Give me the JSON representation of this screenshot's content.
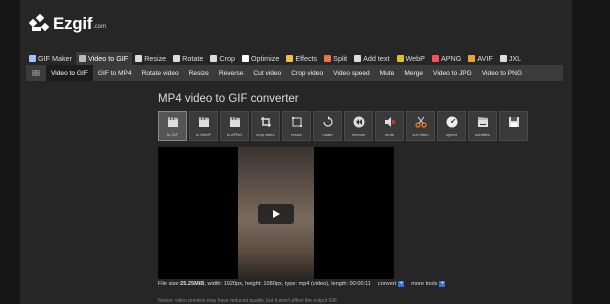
{
  "brand": {
    "name": "Ezgif",
    "suffix": ".com"
  },
  "topnav": [
    {
      "label": "GIF Maker",
      "icon": "gif-maker-icon",
      "color": "#9fc3ff",
      "active": false
    },
    {
      "label": "Video to GIF",
      "icon": "video-icon",
      "color": "#bbbbbb",
      "active": true
    },
    {
      "label": "Resize",
      "icon": "resize-icon",
      "color": "#dddddd",
      "active": false
    },
    {
      "label": "Rotate",
      "icon": "rotate-icon",
      "color": "#dddddd",
      "active": false
    },
    {
      "label": "Crop",
      "icon": "crop-icon",
      "color": "#dddddd",
      "active": false
    },
    {
      "label": "Optimize",
      "icon": "optimize-icon",
      "color": "#ffffff",
      "active": false
    },
    {
      "label": "Effects",
      "icon": "effects-icon",
      "color": "#f0c040",
      "active": false
    },
    {
      "label": "Split",
      "icon": "split-icon",
      "color": "#f07050",
      "active": false
    },
    {
      "label": "Add text",
      "icon": "add-text-icon",
      "color": "#dddddd",
      "active": false
    },
    {
      "label": "WebP",
      "icon": "webp-icon",
      "color": "#e0c020",
      "active": false
    },
    {
      "label": "APNG",
      "icon": "apng-icon",
      "color": "#ff5050",
      "active": false
    },
    {
      "label": "AVIF",
      "icon": "avif-icon",
      "color": "#f0a030",
      "active": false
    },
    {
      "label": "JXL",
      "icon": "jxl-icon",
      "color": "#dddddd",
      "active": false
    }
  ],
  "subnav": [
    {
      "label": "Video to GIF",
      "active": true
    },
    {
      "label": "GIF to MP4",
      "active": false
    },
    {
      "label": "Rotate video",
      "active": false
    },
    {
      "label": "Resize",
      "active": false
    },
    {
      "label": "Reverse",
      "active": false
    },
    {
      "label": "Cut video",
      "active": false
    },
    {
      "label": "Crop video",
      "active": false
    },
    {
      "label": "Video speed",
      "active": false
    },
    {
      "label": "Mute",
      "active": false
    },
    {
      "label": "Merge",
      "active": false
    },
    {
      "label": "Video to JPG",
      "active": false
    },
    {
      "label": "Video to PNG",
      "active": false
    }
  ],
  "page_title": "MP4 video to GIF converter",
  "tools": [
    {
      "label": "to GIF",
      "icon": "clapper-icon",
      "active": true
    },
    {
      "label": "to WebP",
      "icon": "clapper-icon",
      "active": false
    },
    {
      "label": "to APNG",
      "icon": "clapper-icon",
      "active": false
    },
    {
      "label": "crop video",
      "icon": "crop-video-icon",
      "active": false
    },
    {
      "label": "resize",
      "icon": "resize-video-icon",
      "active": false
    },
    {
      "label": "rotate",
      "icon": "rotate-video-icon",
      "active": false
    },
    {
      "label": "reverse",
      "icon": "reverse-icon",
      "active": false
    },
    {
      "label": "mute",
      "icon": "mute-icon",
      "active": false
    },
    {
      "label": "cut video",
      "icon": "scissors-icon",
      "active": false
    },
    {
      "label": "speed",
      "icon": "speed-icon",
      "active": false
    },
    {
      "label": "subtitles",
      "icon": "subtitles-icon",
      "active": false
    },
    {
      "label": "",
      "icon": "save-icon",
      "active": false
    }
  ],
  "file_info": {
    "size_label": "File size: ",
    "size": "25.25MiB",
    "details": ", width: 1920px, height: 1080px, type: mp4 (video), length: 00:00:11",
    "convert": "convert",
    "more_tools": "more tools"
  },
  "notice": "Notice: video preview may have reduced quality, but it won't affect the output GIF.",
  "colors": {
    "accent": "#3b6fd1",
    "page": "#262626",
    "outer": "#161616"
  }
}
